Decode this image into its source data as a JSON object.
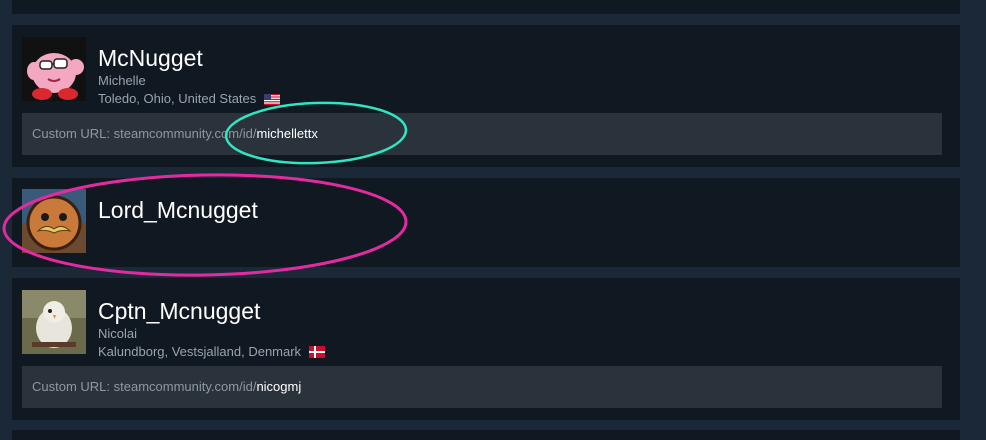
{
  "results": [
    {
      "persona_name": "McNugget",
      "real_name": "Michelle",
      "location": "Toledo, Ohio, United States",
      "flag": "us-flag-icon",
      "custom_url_label": "Custom URL: steamcommunity.com/id/",
      "custom_url_id": "michellettx"
    },
    {
      "persona_name": "Lord_Mcnugget"
    },
    {
      "persona_name": "Cptn_Mcnugget",
      "real_name": "Nicolai",
      "location": "Kalundborg, Vestsjalland, Denmark",
      "flag": "denmark-flag-icon",
      "custom_url_label": "Custom URL: steamcommunity.com/id/",
      "custom_url_id": "nicogmj"
    }
  ],
  "annotation_colors": {
    "cyan_ellipse": "#2ee6c2",
    "magenta_ellipse": "#e22ba0"
  },
  "theme": {
    "page_bg": "#1b2838",
    "card_bg": "#101822",
    "url_bg": "#2a323c"
  }
}
